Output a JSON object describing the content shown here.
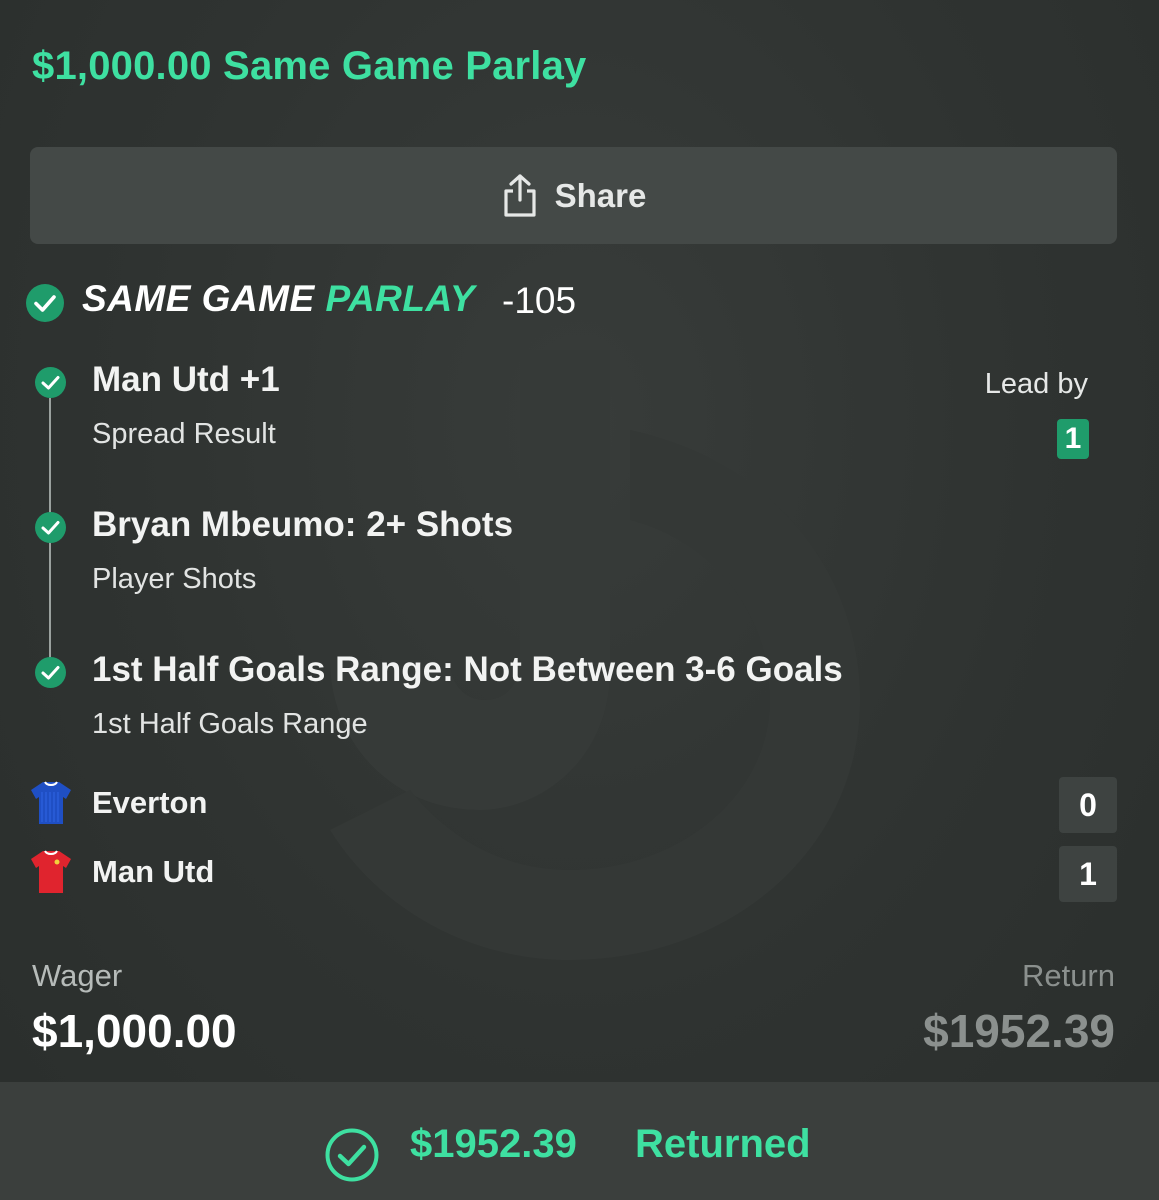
{
  "header": {
    "title": "$1,000.00 Same Game Parlay"
  },
  "share": {
    "label": "Share",
    "icon": "share-icon"
  },
  "parlay": {
    "label_white": "SAME GAME",
    "label_green": "PARLAY",
    "odds": "-105",
    "status_icon": "check-circle-icon"
  },
  "legs": [
    {
      "title": "Man Utd +1",
      "subtitle": "Spread Result",
      "status": "won"
    },
    {
      "title": "Bryan Mbeumo: 2+ Shots",
      "subtitle": "Player Shots",
      "status": "won"
    },
    {
      "title": "1st Half Goals Range: Not Between 3-6 Goals",
      "subtitle": "1st Half Goals Range",
      "status": "won"
    }
  ],
  "lead": {
    "label": "Lead by",
    "value": "1"
  },
  "teams": [
    {
      "name": "Everton",
      "score": "0",
      "jersey_color": "#1f4fc4"
    },
    {
      "name": "Man Utd",
      "score": "1",
      "jersey_color": "#e0242e"
    }
  ],
  "wager": {
    "label": "Wager",
    "value": "$1,000.00"
  },
  "return": {
    "label": "Return",
    "value": "$1952.39"
  },
  "footer": {
    "amount": "$1952.39",
    "text": "Returned",
    "icon": "check-circle-outline-icon"
  },
  "colors": {
    "accent": "#3ee0a1",
    "check_bg": "#1f9c6b",
    "background": "#2f3331"
  }
}
